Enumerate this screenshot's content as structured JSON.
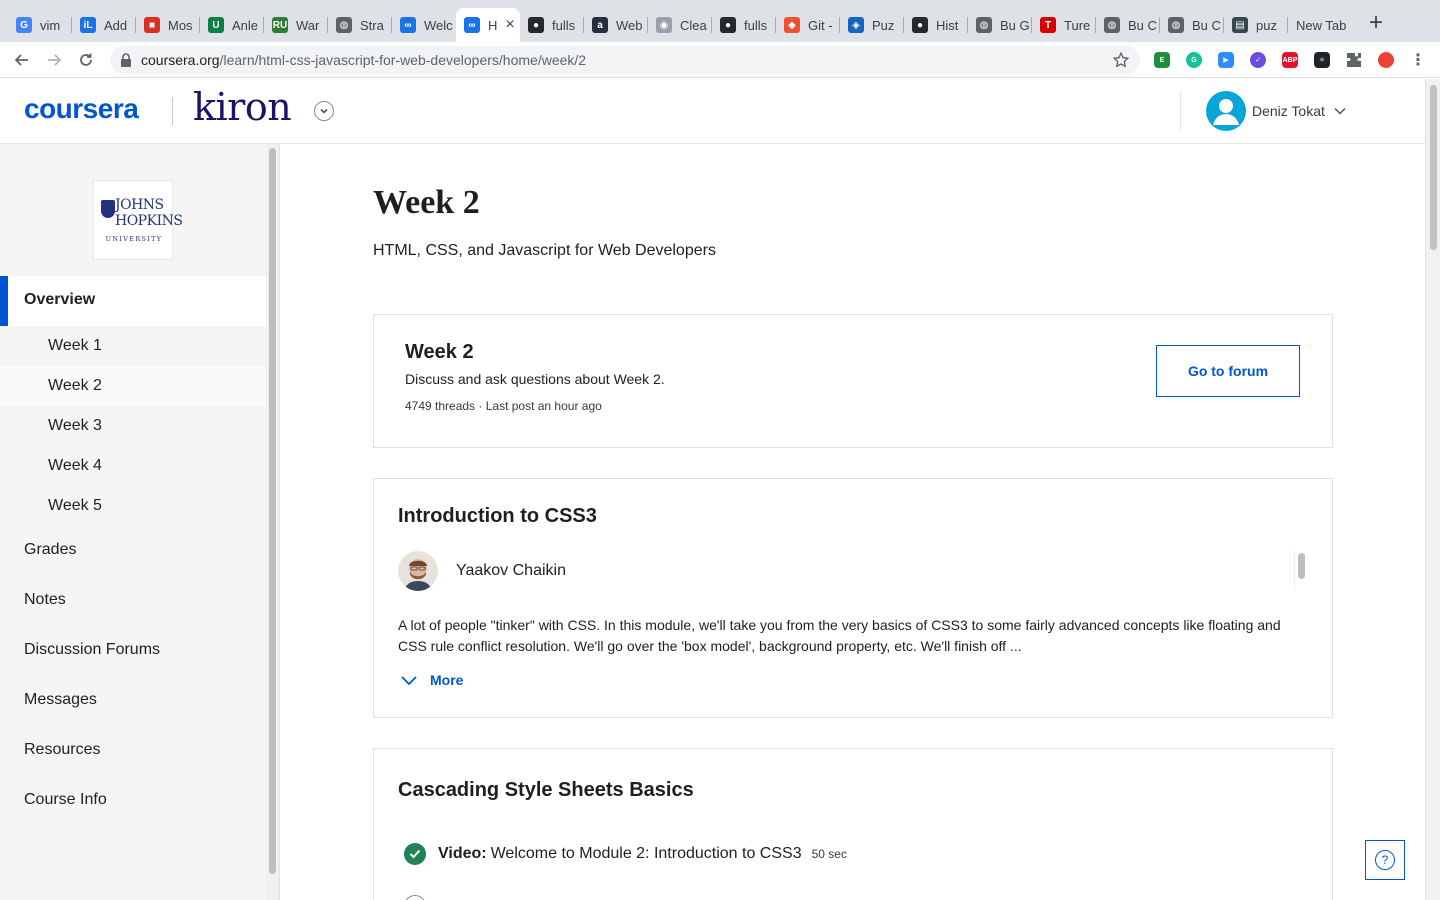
{
  "browser": {
    "tabs": [
      {
        "title": "vim",
        "icon": "google-icon",
        "color": "#4285f4",
        "glyph": "G"
      },
      {
        "title": "Add",
        "icon": "il-icon",
        "color": "#1a73e8",
        "glyph": "iL"
      },
      {
        "title": "Mos",
        "icon": "grid-icon",
        "color": "#d93025",
        "glyph": "■"
      },
      {
        "title": "Anle",
        "icon": "u-icon",
        "color": "#0b8043",
        "glyph": "U"
      },
      {
        "title": "War",
        "icon": "ru-icon",
        "color": "#2e7d32",
        "glyph": "RU"
      },
      {
        "title": "Stra",
        "icon": "globe-icon",
        "color": "#5f6368",
        "glyph": "◍"
      },
      {
        "title": "Welc",
        "icon": "infinity-icon",
        "color": "#1a73e8",
        "glyph": "∞"
      },
      {
        "title": "H",
        "icon": "infinity-icon",
        "color": "#1a73e8",
        "glyph": "∞"
      },
      {
        "title": "fulls",
        "icon": "github-icon",
        "color": "#24292e",
        "glyph": "●"
      },
      {
        "title": "Web",
        "icon": "amazon-icon",
        "color": "#232f3e",
        "glyph": "a"
      },
      {
        "title": "Clea",
        "icon": "shield-icon",
        "color": "#9aa0a6",
        "glyph": "◉"
      },
      {
        "title": "fulls",
        "icon": "github-icon",
        "color": "#24292e",
        "glyph": "●"
      },
      {
        "title": "Git -",
        "icon": "git-icon",
        "color": "#f05032",
        "glyph": "◆"
      },
      {
        "title": "Puz",
        "icon": "puzzle-icon",
        "color": "#1565c0",
        "glyph": "◈"
      },
      {
        "title": "Hist",
        "icon": "github-icon",
        "color": "#24292e",
        "glyph": "●"
      },
      {
        "title": "Bu G",
        "icon": "globe-icon",
        "color": "#5f6368",
        "glyph": "◍"
      },
      {
        "title": "Ture",
        "icon": "tureng-icon",
        "color": "#d50000",
        "glyph": "T"
      },
      {
        "title": "Bu C",
        "icon": "globe-icon",
        "color": "#5f6368",
        "glyph": "◍"
      },
      {
        "title": "Bu C",
        "icon": "globe-icon",
        "color": "#5f6368",
        "glyph": "◍"
      },
      {
        "title": "puz",
        "icon": "notion-icon",
        "color": "#37474f",
        "glyph": "▤"
      },
      {
        "title": "New Tab",
        "icon": "",
        "color": "",
        "glyph": ""
      }
    ],
    "url_host": "coursera.org",
    "url_path": "/learn/html-css-javascript-for-web-developers/home/week/2"
  },
  "header": {
    "brand": "coursera",
    "partner": "kiron",
    "user_name": "Deniz Tokat"
  },
  "sidebar": {
    "university": {
      "line1": "JOHNS",
      "line2": "HOPKINS",
      "line3": "UNIVERSITY"
    },
    "overview": "Overview",
    "weeks": [
      "Week 1",
      "Week 2",
      "Week 3",
      "Week 4",
      "Week 5"
    ],
    "items": [
      "Grades",
      "Notes",
      "Discussion Forums",
      "Messages",
      "Resources",
      "Course Info"
    ]
  },
  "main": {
    "title": "Week 2",
    "subtitle": "HTML, CSS, and Javascript for Web Developers",
    "forum": {
      "title": "Week 2",
      "description": "Discuss and ask questions about Week 2.",
      "meta": "4749 threads · Last post an hour ago",
      "button": "Go to forum"
    },
    "module": {
      "title": "Introduction to CSS3",
      "instructor": "Yaakov Chaikin",
      "description": "A lot of people \"tinker\" with CSS. In this module, we'll take you from the very basics of CSS3 to some fairly advanced concepts like floating and CSS rule conflict resolution. We'll go over the 'box model', background property, etc. We'll finish off ...",
      "more": "More"
    },
    "lessons": {
      "title": "Cascading Style Sheets Basics",
      "items": [
        {
          "type": "Video:",
          "name": "Welcome to Module 2: Introduction to CSS3",
          "duration": "50 sec",
          "completed": true
        }
      ]
    }
  },
  "colors": {
    "accent": "#0056d2",
    "success": "#1f8354",
    "kiron": "#1b1464"
  }
}
